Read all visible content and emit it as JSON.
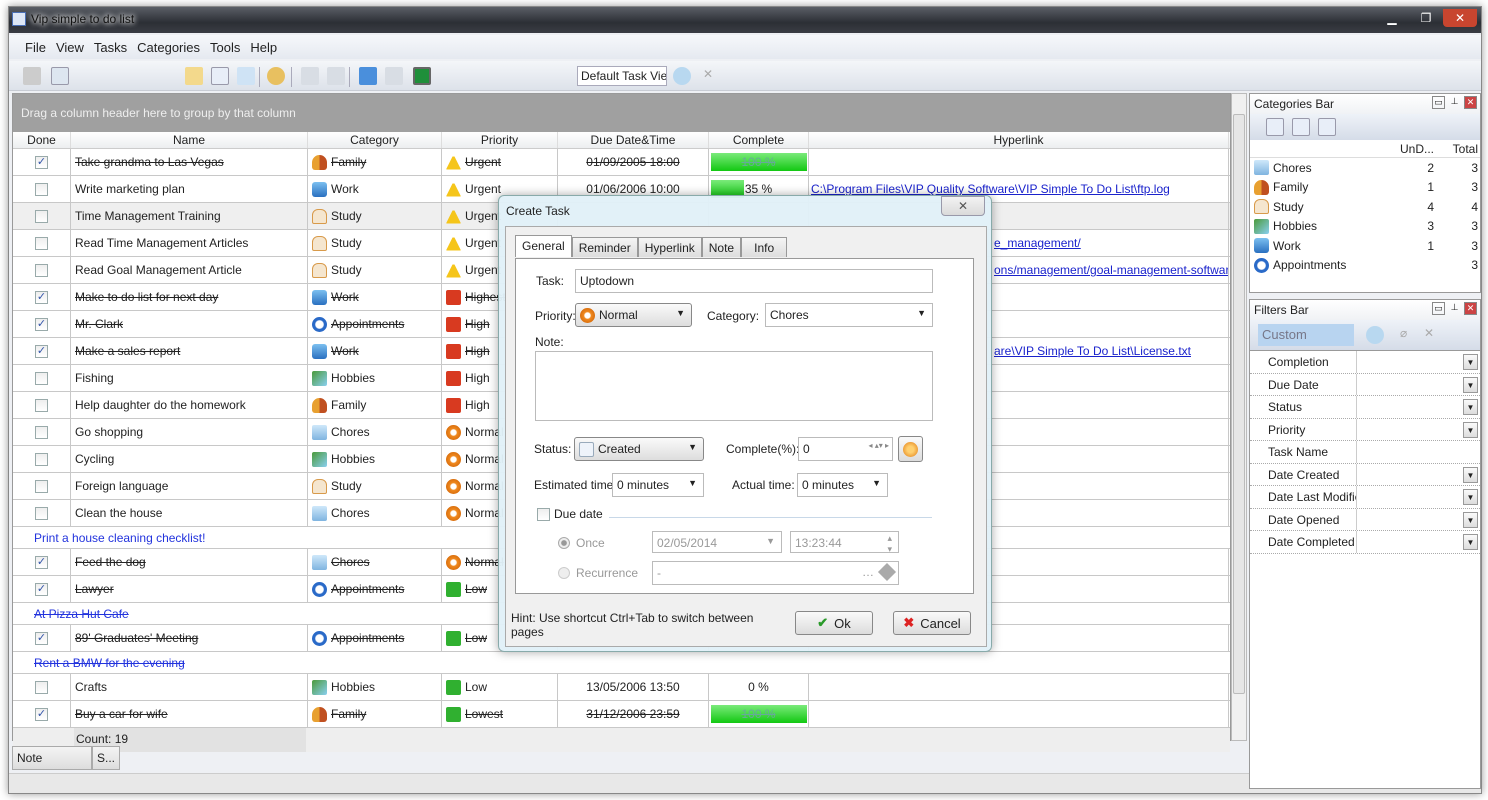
{
  "window": {
    "title": "Vip simple to do list",
    "controls": [
      "▁",
      "❐",
      "✕"
    ]
  },
  "menu": [
    "File",
    "View",
    "Tasks",
    "Categories",
    "Tools",
    "Help"
  ],
  "toolbar": {
    "view_select": "Default Task View"
  },
  "grid": {
    "group_hint": "Drag a column header here to group by that column",
    "columns": [
      "Done",
      "Name",
      "Category",
      "Priority",
      "Due Date&Time",
      "Complete",
      "Hyperlink"
    ],
    "rows": [
      {
        "done": true,
        "name": "Take grandma to Las Vegas",
        "category": "Family",
        "priority": "Urgent",
        "due": "01/09/2005 18:00",
        "complete": 100,
        "complete_label": "100 %",
        "hyperlink": ""
      },
      {
        "done": false,
        "name": "Write marketing plan",
        "category": "Work",
        "priority": "Urgent",
        "due": "01/06/2006 10:00",
        "complete": 35,
        "complete_label": "35 %",
        "hyperlink": "C:\\Program Files\\VIP Quality Software\\VIP Simple To Do List\\ftp.log"
      },
      {
        "done": false,
        "name": "Time Management Training",
        "category": "Study",
        "priority": "Urgent",
        "due": "",
        "complete": null,
        "complete_label": "",
        "hyperlink": "",
        "selected": true
      },
      {
        "done": false,
        "name": "Read Time Management Articles",
        "category": "Study",
        "priority": "Urgent",
        "due": "",
        "complete": null,
        "complete_label": "",
        "hyperlink": "e_management/",
        "partial": true
      },
      {
        "done": false,
        "name": "Read Goal Management Article",
        "category": "Study",
        "priority": "Urgent",
        "due": "",
        "complete": null,
        "complete_label": "",
        "hyperlink": "ons/management/goal-management-software",
        "partial": true
      },
      {
        "done": true,
        "name": "Make to do list for next day",
        "category": "Work",
        "priority": "Highest",
        "due": "",
        "complete": null,
        "complete_label": "",
        "hyperlink": ""
      },
      {
        "done": true,
        "name": "Mr. Clark",
        "category": "Appointments",
        "priority": "High",
        "due": "",
        "complete": null,
        "complete_label": "",
        "hyperlink": ""
      },
      {
        "done": true,
        "name": "Make a sales report",
        "category": "Work",
        "priority": "High",
        "due": "",
        "complete": null,
        "complete_label": "",
        "hyperlink": "are\\VIP Simple To Do List\\License.txt",
        "partial": true
      },
      {
        "done": false,
        "name": "Fishing",
        "category": "Hobbies",
        "priority": "High",
        "due": "",
        "complete": null,
        "complete_label": "",
        "hyperlink": ""
      },
      {
        "done": false,
        "name": "Help daughter do the homework",
        "category": "Family",
        "priority": "High",
        "due": "",
        "complete": null,
        "complete_label": "",
        "hyperlink": ""
      },
      {
        "done": false,
        "name": "Go shopping",
        "category": "Chores",
        "priority": "Normal",
        "due": "",
        "complete": null,
        "complete_label": "",
        "hyperlink": ""
      },
      {
        "done": false,
        "name": "Cycling",
        "category": "Hobbies",
        "priority": "Normal",
        "due": "",
        "complete": null,
        "complete_label": "",
        "hyperlink": ""
      },
      {
        "done": false,
        "name": "Foreign language",
        "category": "Study",
        "priority": "Normal",
        "due": "",
        "complete": null,
        "complete_label": "",
        "hyperlink": ""
      },
      {
        "done": false,
        "name": "Clean the house",
        "category": "Chores",
        "priority": "Normal",
        "due": "",
        "complete": null,
        "complete_label": "",
        "hyperlink": ""
      },
      {
        "note": "Print a house cleaning checklist!",
        "struck": false
      },
      {
        "done": true,
        "name": "Feed the dog",
        "category": "Chores",
        "priority": "Normal",
        "due": "",
        "complete": null,
        "complete_label": "",
        "hyperlink": ""
      },
      {
        "done": true,
        "name": "Lawyer",
        "category": "Appointments",
        "priority": "Low",
        "due": "",
        "complete": null,
        "complete_label": "",
        "hyperlink": ""
      },
      {
        "note": "At Pizza Hut Cafe",
        "struck": true
      },
      {
        "done": true,
        "name": "89' Graduates' Meeting",
        "category": "Appointments",
        "priority": "Low",
        "due": "",
        "complete": null,
        "complete_label": "",
        "hyperlink": ""
      },
      {
        "note": "Rent a BMW for the evening",
        "struck": true
      },
      {
        "done": false,
        "name": "Crafts",
        "category": "Hobbies",
        "priority": "Low",
        "due": "13/05/2006 13:50",
        "complete": 0,
        "complete_label": "0 %",
        "hyperlink": ""
      },
      {
        "done": true,
        "name": "Buy a car for wife",
        "category": "Family",
        "priority": "Lowest",
        "due": "31/12/2006 23:59",
        "complete": 100,
        "complete_label": "100 %",
        "hyperlink": ""
      }
    ],
    "count": "Count: 19"
  },
  "bottom_tabs": [
    "Note",
    "S..."
  ],
  "categories_bar": {
    "title": "Categories Bar",
    "columns": [
      "UnD...",
      "Total"
    ],
    "items": [
      {
        "name": "Chores",
        "undone": "2",
        "total": "3"
      },
      {
        "name": "Family",
        "undone": "1",
        "total": "3"
      },
      {
        "name": "Study",
        "undone": "4",
        "total": "4"
      },
      {
        "name": "Hobbies",
        "undone": "3",
        "total": "3"
      },
      {
        "name": "Work",
        "undone": "1",
        "total": "3"
      },
      {
        "name": "Appointments",
        "undone": "",
        "total": "3"
      }
    ]
  },
  "filters_bar": {
    "title": "Filters Bar",
    "preset": "Custom",
    "fields": [
      {
        "label": "Completion",
        "dd": true
      },
      {
        "label": "Due Date",
        "dd": true
      },
      {
        "label": "Status",
        "dd": true
      },
      {
        "label": "Priority",
        "dd": true
      },
      {
        "label": "Task Name",
        "dd": false
      },
      {
        "label": "Date Created",
        "dd": true
      },
      {
        "label": "Date Last Modified",
        "dd": true
      },
      {
        "label": "Date Opened",
        "dd": true
      },
      {
        "label": "Date Completed",
        "dd": true
      }
    ]
  },
  "dialog": {
    "title": "Create Task",
    "tabs": [
      "General",
      "Reminder",
      "Hyperlink",
      "Note",
      "Info"
    ],
    "task_label": "Task:",
    "task_value": "Uptodown",
    "priority_label": "Priority:",
    "priority_value": "Normal",
    "category_label": "Category:",
    "category_value": "Chores",
    "note_label": "Note:",
    "note_value": "",
    "status_label": "Status:",
    "status_value": "Created",
    "complete_label": "Complete(%):",
    "complete_value": "0",
    "est_label": "Estimated time:",
    "est_value": "0 minutes",
    "act_label": "Actual time:",
    "act_value": "0 minutes",
    "due_label": "Due date",
    "due_checked": false,
    "once_label": "Once",
    "once_date": "02/05/2014",
    "once_time": "13:23:44",
    "recur_label": "Recurrence",
    "recur_value": "-",
    "hint": "Hint: Use shortcut Ctrl+Tab to switch between pages",
    "ok": "Ok",
    "cancel": "Cancel"
  },
  "colors": {
    "progress": "#12c812",
    "link": "#1a22cc",
    "note": "#2233dd",
    "group_bar": "#a0a0a0"
  }
}
